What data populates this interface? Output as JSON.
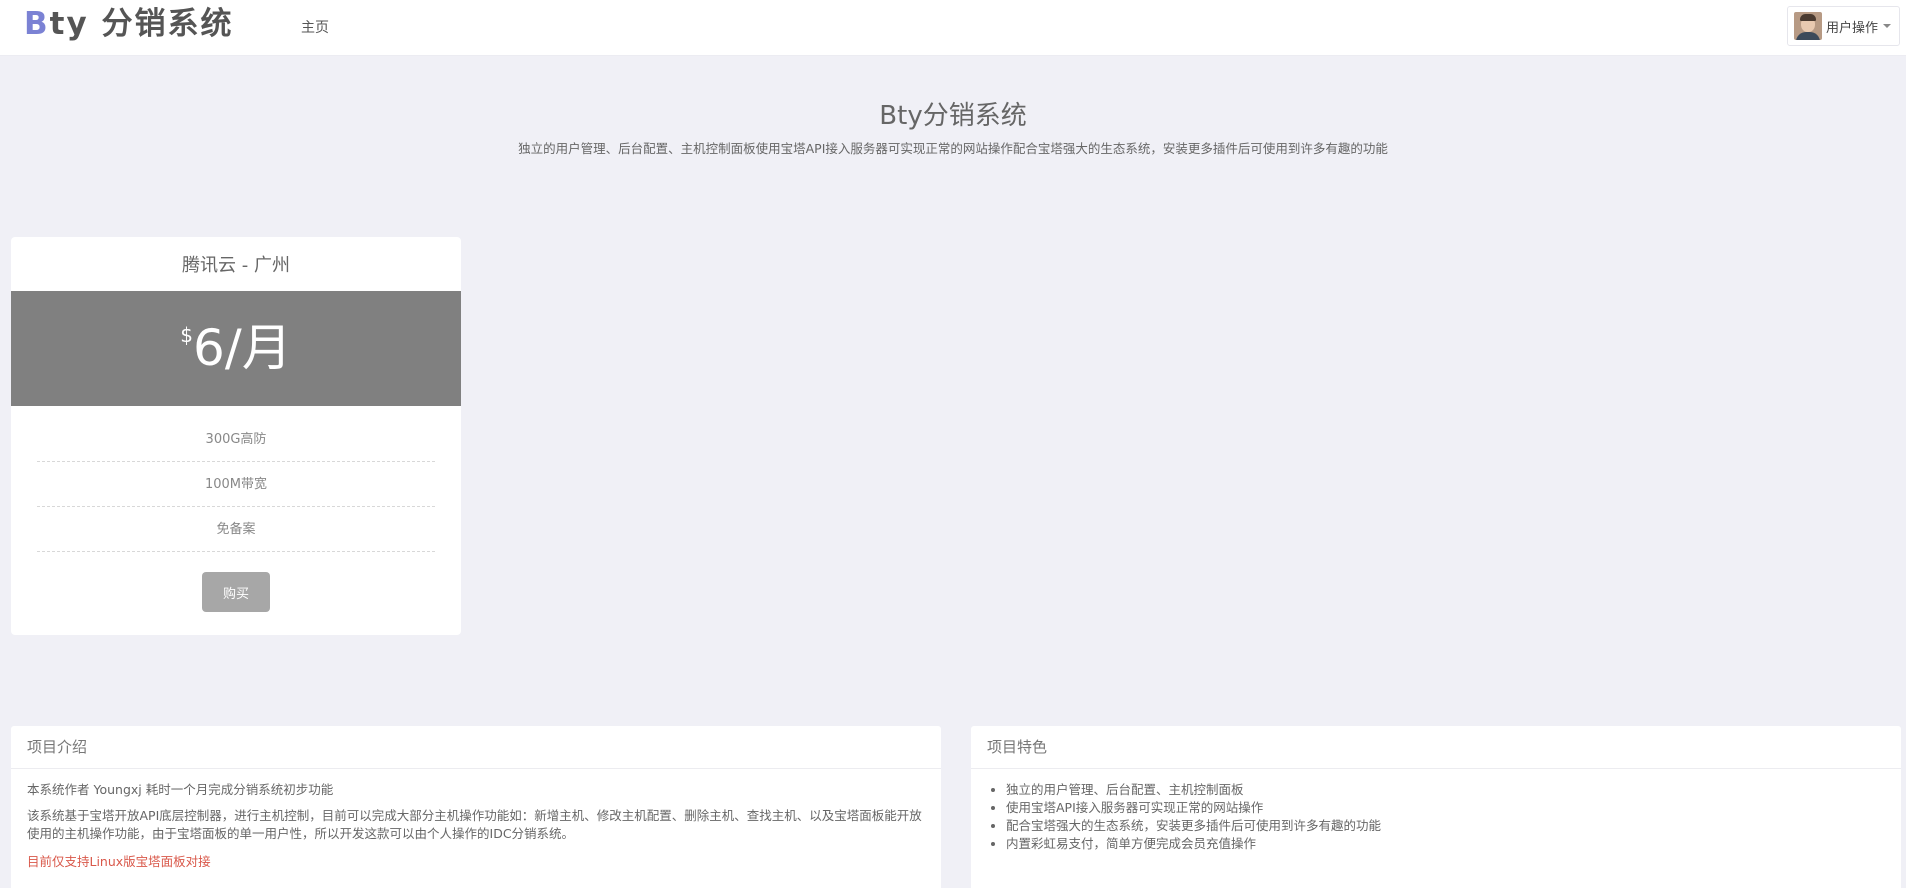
{
  "navbar": {
    "brand_initial": "B",
    "brand_rest": "ty 分销系统",
    "home_link": "主页",
    "user_menu_label": "用户操作"
  },
  "hero": {
    "title": "Bty分销系统",
    "subtitle": "独立的用户管理、后台配置、主机控制面板使用宝塔API接入服务器可实现正常的网站操作配合宝塔强大的生态系统，安装更多插件后可使用到许多有趣的功能"
  },
  "plan": {
    "name": "腾讯云 - 广州",
    "currency": "$",
    "price": "6/月",
    "features": [
      "300G高防",
      "100M带宽",
      "免备案"
    ],
    "buy_label": "购买"
  },
  "intro_panel": {
    "heading": "项目介绍",
    "line1": "本系统作者 Youngxj 耗时一个月完成分销系统初步功能",
    "line2": "该系统基于宝塔开放API底层控制器，进行主机控制，目前可以完成大部分主机操作功能如：新增主机、修改主机配置、删除主机、查找主机、以及宝塔面板能开放使用的主机操作功能，由于宝塔面板的单一用户性，所以开发这款可以由个人操作的IDC分销系统。",
    "note": "目前仅支持Linux版宝塔面板对接"
  },
  "traits_panel": {
    "heading": "项目特色",
    "items": [
      "独立的用户管理、后台配置、主机控制面板",
      "使用宝塔API接入服务器可实现正常的网站操作",
      "配合宝塔强大的生态系统，安装更多插件后可使用到许多有趣的功能",
      "内置彩虹易支付，简单方便完成会员充值操作"
    ]
  },
  "colors": {
    "page_background": "#f0f0f6",
    "brand_accent": "#7b82d4",
    "price_band": "#808080",
    "buy_button": "#a7a7a7",
    "warning_text": "#d9584a"
  }
}
